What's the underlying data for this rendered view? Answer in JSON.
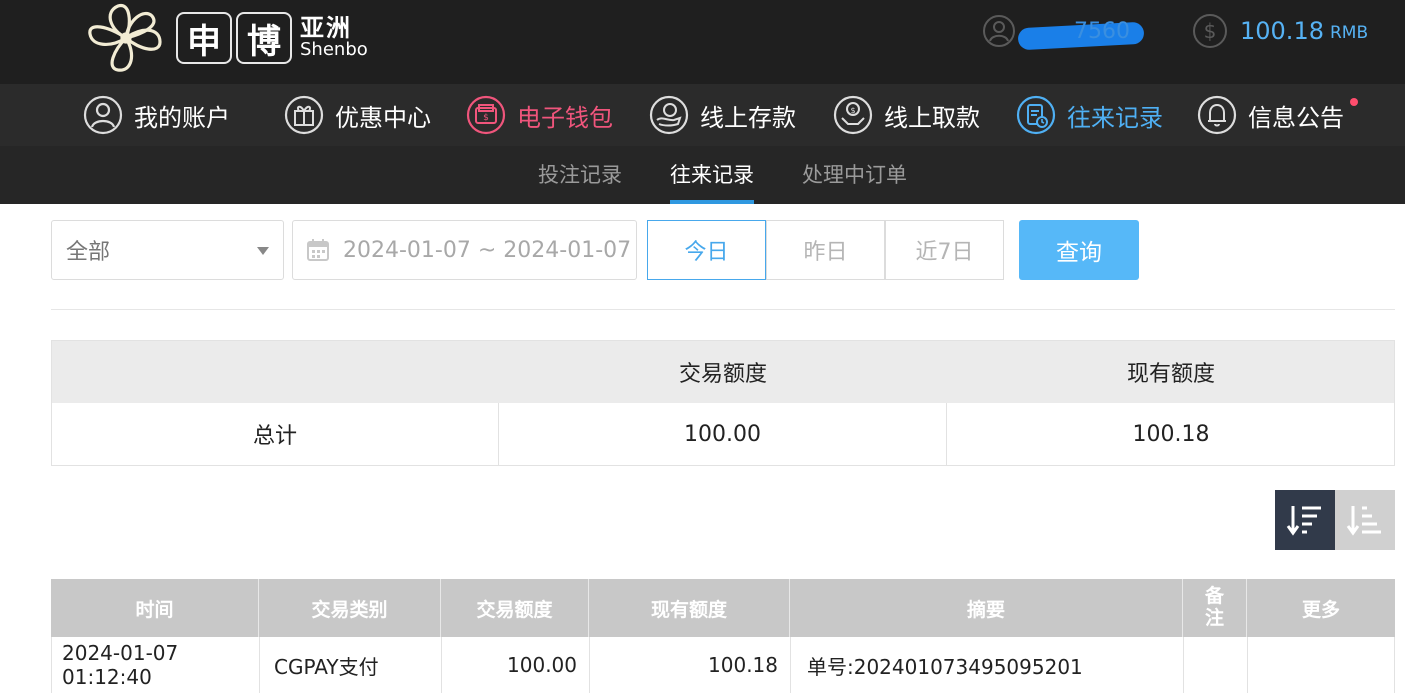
{
  "brand": {
    "box1": "申",
    "box2": "博",
    "cn": "亚洲",
    "en": "Shenbo"
  },
  "user": {
    "name_partial": "7560",
    "balance": "100.18",
    "currency": "RMB"
  },
  "nav": [
    {
      "label": "我的账户",
      "icon": "user-circle-icon"
    },
    {
      "label": "优惠中心",
      "icon": "gift-icon"
    },
    {
      "label": "电子钱包",
      "icon": "wallet-icon",
      "color": "#f0557c"
    },
    {
      "label": "线上存款",
      "icon": "deposit-icon"
    },
    {
      "label": "线上取款",
      "icon": "withdraw-icon"
    },
    {
      "label": "往来记录",
      "icon": "records-icon",
      "color": "#4fb0f4"
    },
    {
      "label": "信息公告",
      "icon": "bell-icon"
    }
  ],
  "subnav": {
    "tabs": [
      "投注记录",
      "往来记录",
      "处理中订单"
    ],
    "active": "往来记录"
  },
  "filter": {
    "type_value": "全部",
    "date_range": "2024-01-07 ~ 2024-01-07",
    "quick": [
      "今日",
      "昨日",
      "近7日"
    ],
    "quick_active": "今日",
    "query_label": "查询"
  },
  "summary": {
    "headers": [
      "",
      "交易额度",
      "现有额度"
    ],
    "row_label": "总计",
    "trade_amount": "100.00",
    "current_amount": "100.18"
  },
  "records": {
    "headers": [
      "时间",
      "交易类别",
      "交易额度",
      "现有额度",
      "摘要",
      "备注",
      "更多"
    ],
    "rows": [
      [
        "2024-01-07 01:12:40",
        "CGPAY支付",
        "100.00",
        "100.18",
        "单号:202401073495095201",
        "",
        ""
      ]
    ]
  },
  "colors": {
    "accent_blue": "#4fb0f4",
    "accent_pink": "#f0557c",
    "query_button": "#56b8f8"
  }
}
